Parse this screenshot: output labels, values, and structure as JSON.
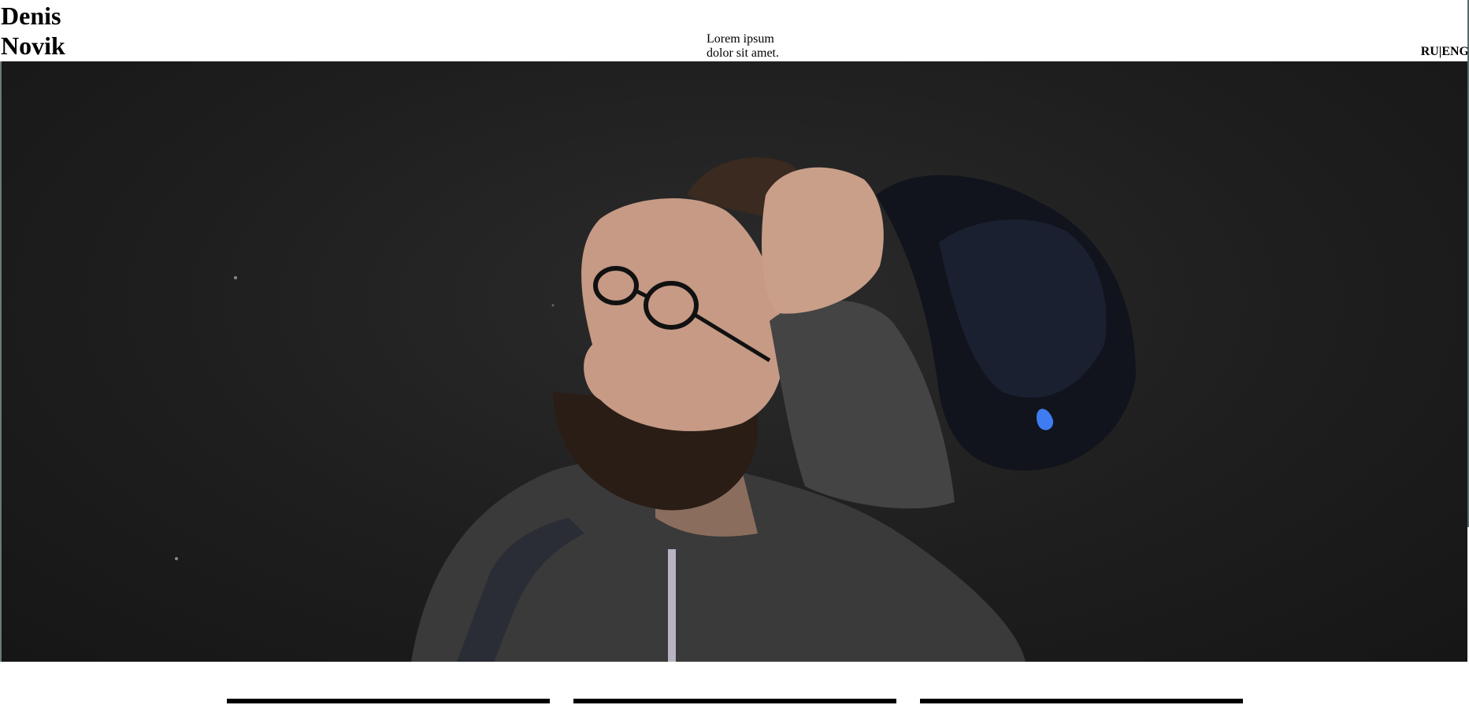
{
  "header": {
    "brand_line1": "Denis",
    "brand_line2": "Novik",
    "tagline": "Lorem ipsum dolor sit amet.",
    "lang_ru": "RU",
    "lang_sep": "|",
    "lang_en": "ENG"
  },
  "hero": {
    "alt": "Portrait photo of a bearded man in glasses holding a cap against a dark wall"
  },
  "cards": {
    "count": 3
  },
  "colors": {
    "accent_cursor": "#3f7cf2",
    "hero_background": "#1e1e1e",
    "card_bar": "#000000"
  }
}
